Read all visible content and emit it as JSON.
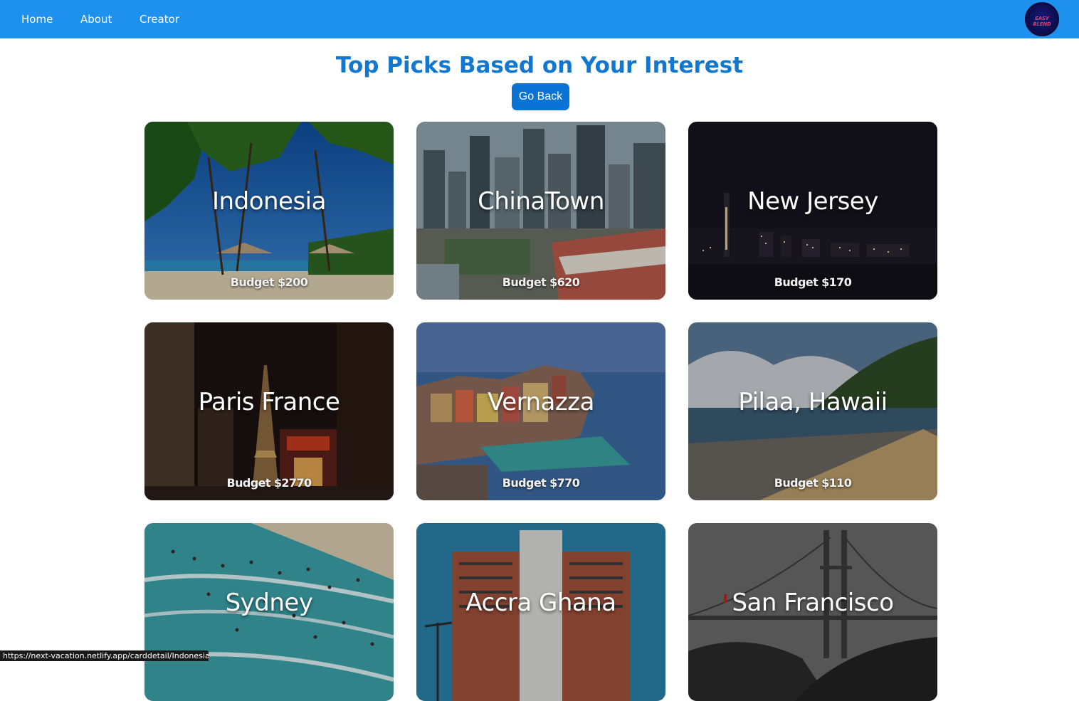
{
  "nav": {
    "links": [
      "Home",
      "About",
      "Creator"
    ],
    "logo_text": "EASY BLEND"
  },
  "page": {
    "title": "Top Picks Based on Your Interest",
    "go_back_label": "Go Back"
  },
  "cards": [
    {
      "name": "Indonesia",
      "budget": "Budget $200",
      "scene": "beach"
    },
    {
      "name": "ChinaTown",
      "budget": "Budget $620",
      "scene": "city-day"
    },
    {
      "name": "New Jersey",
      "budget": "Budget $170",
      "scene": "city-night"
    },
    {
      "name": "Paris France",
      "budget": "Budget $2770",
      "scene": "paris-night"
    },
    {
      "name": "Vernazza",
      "budget": "Budget $770",
      "scene": "coastal-village"
    },
    {
      "name": "Pilaa, Hawaii",
      "budget": "Budget $110",
      "scene": "hawaii-beach"
    },
    {
      "name": "Sydney",
      "budget": "",
      "scene": "ocean-swimmers"
    },
    {
      "name": "Accra Ghana",
      "budget": "",
      "scene": "building"
    },
    {
      "name": "San Francisco",
      "budget": "",
      "scene": "golden-gate"
    }
  ],
  "status_bar": {
    "url": "https://next-vacation.netlify.app/carddetail/Indonesia"
  },
  "colors": {
    "navbar": "#1e90ee",
    "title": "#1177d1",
    "button": "#0b72d6"
  }
}
